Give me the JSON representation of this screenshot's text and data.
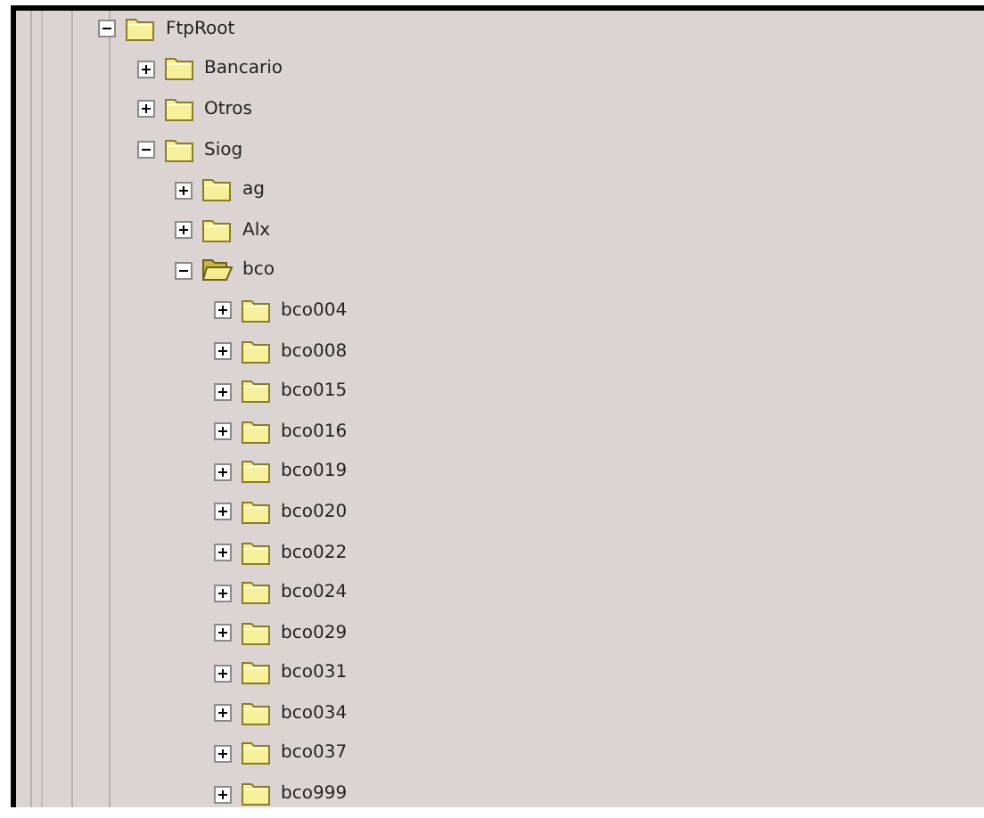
{
  "tree": {
    "items": [
      {
        "label": "FtpRoot",
        "expanded": true,
        "selected": false,
        "children": [
          {
            "label": "Bancario",
            "expanded": false,
            "selected": false
          },
          {
            "label": "Otros",
            "expanded": false,
            "selected": false
          },
          {
            "label": "Siog",
            "expanded": true,
            "selected": false,
            "children": [
              {
                "label": "ag",
                "expanded": false,
                "selected": false
              },
              {
                "label": "Alx",
                "expanded": false,
                "selected": false
              },
              {
                "label": "bco",
                "expanded": true,
                "selected": true,
                "children": [
                  {
                    "label": "bco004",
                    "expanded": false,
                    "selected": false
                  },
                  {
                    "label": "bco008",
                    "expanded": false,
                    "selected": false
                  },
                  {
                    "label": "bco015",
                    "expanded": false,
                    "selected": false
                  },
                  {
                    "label": "bco016",
                    "expanded": false,
                    "selected": false
                  },
                  {
                    "label": "bco019",
                    "expanded": false,
                    "selected": false
                  },
                  {
                    "label": "bco020",
                    "expanded": false,
                    "selected": false
                  },
                  {
                    "label": "bco022",
                    "expanded": false,
                    "selected": false
                  },
                  {
                    "label": "bco024",
                    "expanded": false,
                    "selected": false
                  },
                  {
                    "label": "bco029",
                    "expanded": false,
                    "selected": false
                  },
                  {
                    "label": "bco031",
                    "expanded": false,
                    "selected": false
                  },
                  {
                    "label": "bco034",
                    "expanded": false,
                    "selected": false
                  },
                  {
                    "label": "bco037",
                    "expanded": false,
                    "selected": false
                  },
                  {
                    "label": "bco999",
                    "expanded": false,
                    "selected": false
                  }
                ]
              }
            ]
          }
        ]
      }
    ]
  }
}
